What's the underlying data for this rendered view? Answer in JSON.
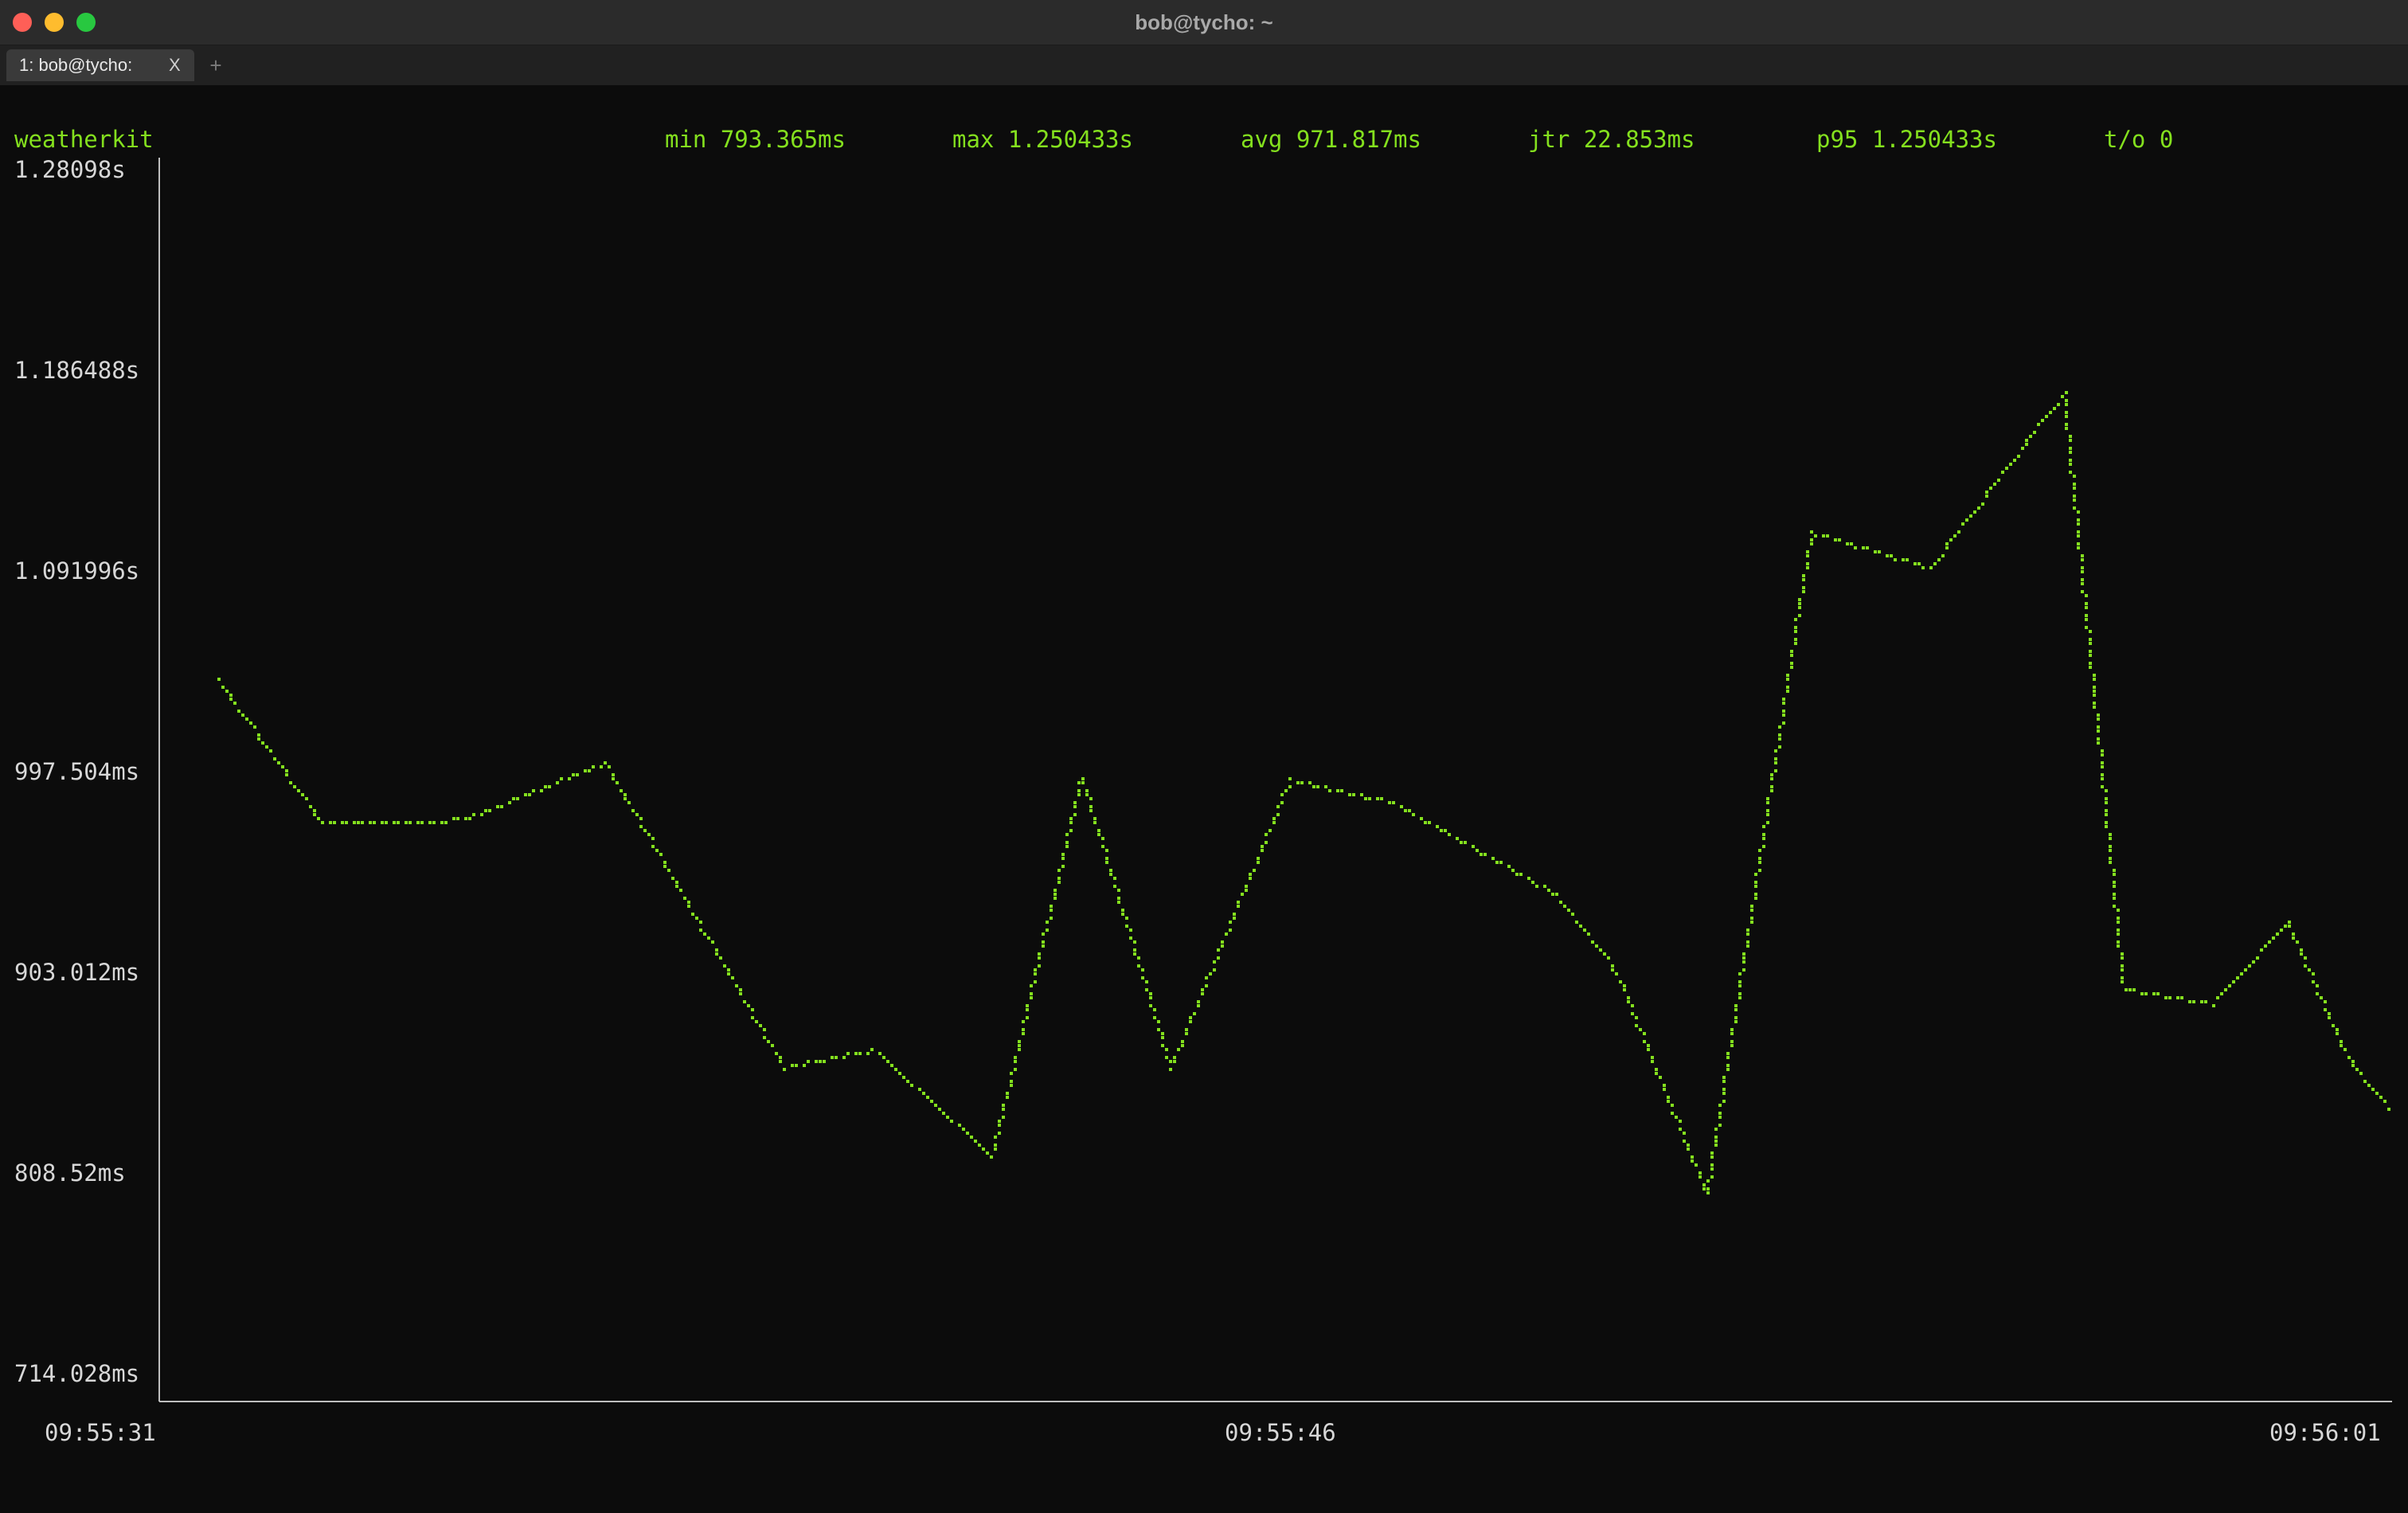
{
  "window": {
    "title": "bob@tycho: ~"
  },
  "tabs": [
    {
      "label": "1: bob@tycho:",
      "close": "X",
      "active": true
    }
  ],
  "new_tab": "+",
  "target": "weatherkit",
  "stats": {
    "min": "min 793.365ms",
    "max": "max 1.250433s",
    "avg": "avg 971.817ms",
    "jtr": "jtr 22.853ms",
    "p95": "p95 1.250433s",
    "timeouts": "t/o 0"
  },
  "colors": {
    "line": "#84e01e",
    "text": "#d7d7d7",
    "axis": "#bfbfbf",
    "background": "#0c0c0c"
  },
  "chart_data": {
    "type": "line",
    "ylim": [
      714.028,
      1280.98
    ],
    "yunit": "ms",
    "y_ticks": [
      "1.28098s",
      "1.186488s",
      "1.091996s",
      "997.504ms",
      "903.012ms",
      "808.52ms",
      "714.028ms"
    ],
    "x_ticks": [
      "09:55:31",
      "09:55:46",
      "09:56:01"
    ],
    "xlim": [
      "09:55:31",
      "09:56:01"
    ],
    "series": [
      {
        "points": [
          [
            "09:55:31.8",
            1043
          ],
          [
            "09:55:33.2",
            975
          ],
          [
            "09:55:35.1",
            977
          ],
          [
            "09:55:37.0",
            1004
          ],
          [
            "09:55:39.4",
            860
          ],
          [
            "09:55:40.6",
            868
          ],
          [
            "09:55:42.2",
            818
          ],
          [
            "09:55:43.4",
            997
          ],
          [
            "09:55:44.6",
            860
          ],
          [
            "09:55:46.2",
            996
          ],
          [
            "09:55:47.6",
            985
          ],
          [
            "09:55:49.8",
            941
          ],
          [
            "09:55:50.6",
            904
          ],
          [
            "09:55:51.8",
            800
          ],
          [
            "09:55:53.2",
            1113
          ],
          [
            "09:55:54.8",
            1096
          ],
          [
            "09:55:56.6",
            1179
          ],
          [
            "09:55:57.4",
            897
          ],
          [
            "09:55:58.6",
            890
          ],
          [
            "09:55:59.6",
            929
          ],
          [
            "09:56:00.4",
            865
          ],
          [
            "09:56:01.0",
            839
          ]
        ]
      }
    ],
    "grid": false
  }
}
